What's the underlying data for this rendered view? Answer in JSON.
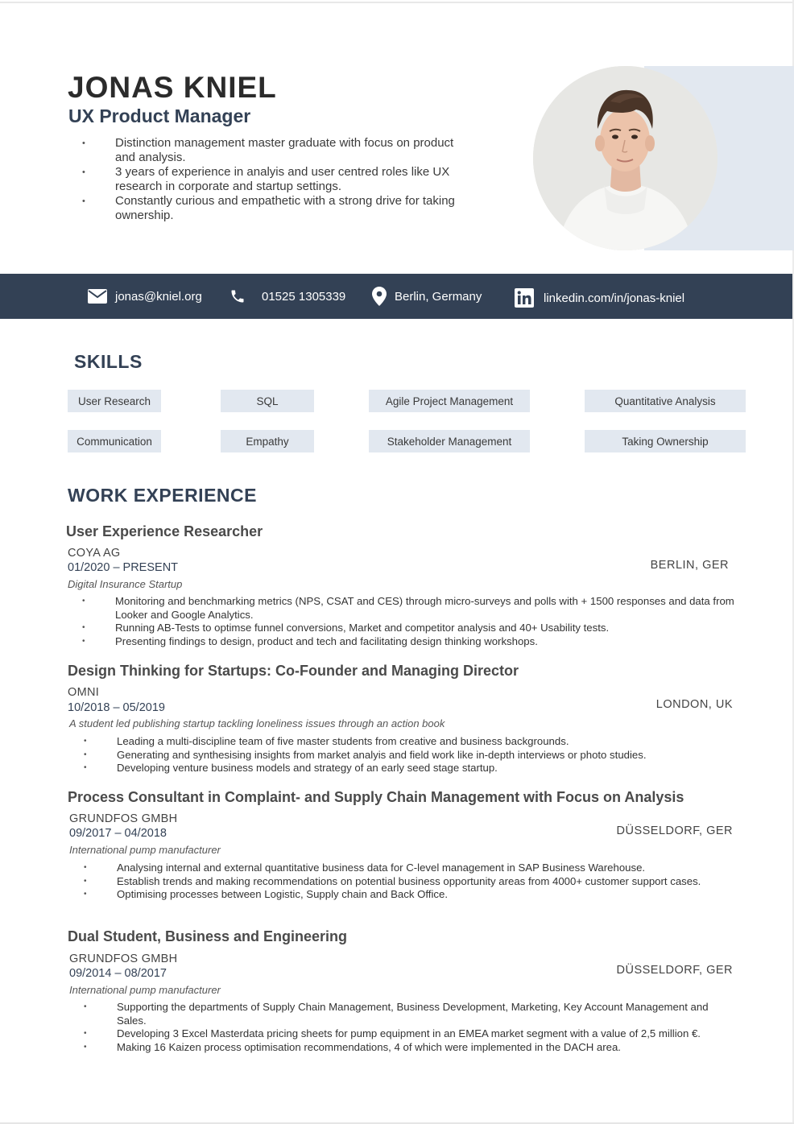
{
  "header": {
    "name": "JONAS KNIEL",
    "role": "UX Product Manager",
    "summary": [
      "Distinction management master graduate with focus on product and analysis.",
      "3 years of experience in analyis and user centred roles like UX research in corporate and startup settings.",
      "Constantly curious and empathetic with a strong drive for taking ownership."
    ]
  },
  "contact": {
    "email": "jonas@kniel.org",
    "phone": "01525 1305339",
    "location": "Berlin, Germany",
    "linkedin": "linkedin.com/in/jonas-kniel"
  },
  "skills": {
    "heading": "SKILLS",
    "items": [
      "User Research",
      "SQL",
      "Agile Project Management",
      "Quantitative Analysis",
      "Communication",
      "Empathy",
      "Stakeholder Management",
      "Taking Ownership"
    ]
  },
  "work": {
    "heading": "WORK EXPERIENCE",
    "jobs": [
      {
        "title": "User Experience Researcher",
        "company": "COYA AG",
        "dates": "01/2020 – PRESENT",
        "location": "BERLIN, GER",
        "description": "Digital Insurance Startup",
        "bullets": [
          "Monitoring and benchmarking metrics (NPS, CSAT and CES) through micro-surveys and polls with + 1500 responses and data from Looker and Google Analytics.",
          "Running AB-Tests to optimse funnel conversions, Market and competitor analysis and 40+ Usability tests.",
          "Presenting findings to design, product and tech and facilitating design thinking workshops."
        ]
      },
      {
        "title": "Design Thinking for Startups: Co-Founder and Managing Director",
        "company": "OMNI",
        "dates": "10/2018 – 05/2019",
        "location": "LONDON, UK",
        "description": "A student led publishing startup tackling loneliness issues through an action book",
        "bullets": [
          "Leading a multi-discipline team of five master students from creative and business backgrounds.",
          "Generating and synthesising insights from market analyis and field work like in-depth interviews or photo studies.",
          "Developing venture business models and strategy of an early seed stage startup."
        ]
      },
      {
        "title": "Process Consultant in Complaint- and Supply Chain Management with Focus on Analysis",
        "company": "GRUNDFOS GMBH",
        "dates": "09/2017 – 04/2018",
        "location": "DÜSSELDORF, GER",
        "description": "International pump manufacturer",
        "bullets": [
          "Analysing internal and external quantitative business data for C-level management in SAP Business Warehouse.",
          "Establish trends and making recommendations on potential business opportunity areas from 4000+ customer support cases.",
          "Optimising processes between Logistic, Supply chain and Back Office."
        ]
      },
      {
        "title": "Dual Student, Business and Engineering",
        "company": "GRUNDFOS GMBH",
        "dates": "09/2014 – 08/2017",
        "location": "DÜSSELDORF, GER",
        "description": "International pump manufacturer",
        "bullets": [
          "Supporting the departments of Supply Chain Management, Business Development, Marketing, Key Account Management and Sales.",
          "Developing 3 Excel Masterdata pricing sheets for pump equipment in an EMEA market segment with a value of 2,5 million €.",
          "Making 16 Kaizen process optimisation recommendations, 4 of which were implemented in the DACH area."
        ]
      }
    ]
  }
}
